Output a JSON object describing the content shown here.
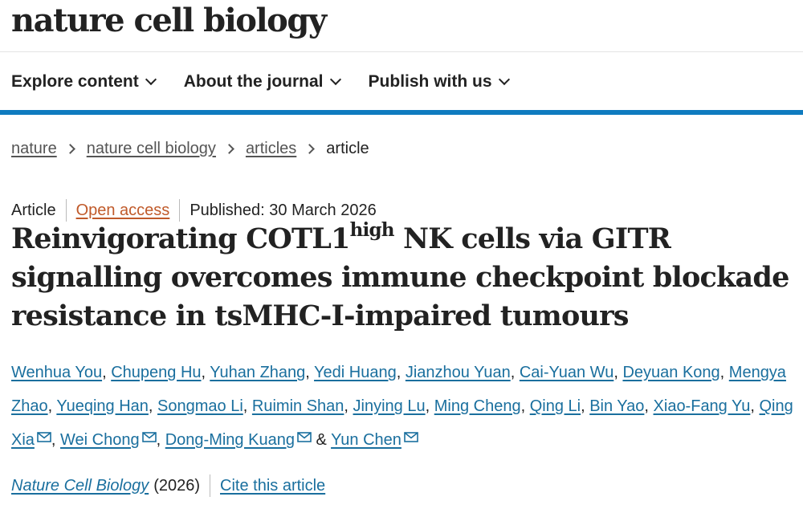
{
  "header": {
    "logo": "nature cell biology"
  },
  "nav": {
    "items": [
      {
        "label": "Explore content"
      },
      {
        "label": "About the journal"
      },
      {
        "label": "Publish with us"
      }
    ]
  },
  "breadcrumb": {
    "items": [
      "nature",
      "nature cell biology",
      "articles"
    ],
    "current": "article"
  },
  "article": {
    "type": "Article",
    "access": "Open access",
    "published": "Published: 30 March 2026",
    "title_part1": "Reinvigorating COTL1",
    "title_sup": "high",
    "title_part2": " NK cells via GITR signalling overcomes immune checkpoint blockade resistance in tsMHC-I-impaired tumours",
    "authors": [
      "Wenhua You",
      "Chupeng Hu",
      "Yuhan Zhang",
      "Yedi Huang",
      "Jianzhou Yuan",
      "Cai-Yuan Wu",
      "Deyuan Kong",
      "Mengya Zhao",
      "Yueqing Han",
      "Songmao Li",
      "Ruimin Shan",
      "Jinying Lu",
      "Ming Cheng",
      "Qing Li",
      "Bin Yao",
      "Xiao-Fang Yu",
      "Qing Xia",
      "Wei Chong",
      "Dong-Ming Kuang",
      "Yun Chen"
    ],
    "author_and": "&",
    "journal": "Nature Cell Biology",
    "year": "(2026)",
    "cite": "Cite this article"
  },
  "icons": {
    "mail": "mail-icon",
    "chevron": "chevron-down-icon",
    "crumb_separator": "chevron-right-icon"
  },
  "colors": {
    "link": "#1a6f9e",
    "open_access": "#c05a2a",
    "accent_bar": "#0f7bbf"
  }
}
